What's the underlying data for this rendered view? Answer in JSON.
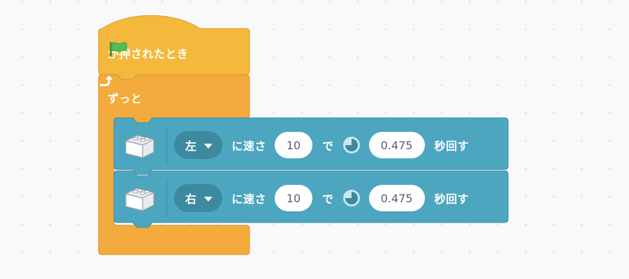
{
  "hat": {
    "icon": "green-flag-icon",
    "label": "が押されたとき",
    "color": "#f4b93c"
  },
  "forever": {
    "label": "ずっと",
    "color": "#f2ab3c",
    "icon": "loop-arrow-icon"
  },
  "motor_blocks": [
    {
      "icon": "lego-brick-icon",
      "direction": "左",
      "text_speed": "に速さ",
      "speed": "10",
      "text_de": "で",
      "clock_icon": "clock-icon",
      "duration": "0.475",
      "text_seconds": "秒回す"
    },
    {
      "icon": "lego-brick-icon",
      "direction": "右",
      "text_speed": "に速さ",
      "speed": "10",
      "text_de": "で",
      "clock_icon": "clock-icon",
      "duration": "0.475",
      "text_seconds": "秒回す"
    }
  ],
  "colors": {
    "motor_block": "#4ca6bf",
    "motor_block_border": "#3b8ea6",
    "dropdown": "#3d8aa0",
    "hat_block": "#f4b93c",
    "forever_block": "#f2ab3c",
    "flag": "#4cbf56",
    "workspace": "#f9f9f9"
  }
}
